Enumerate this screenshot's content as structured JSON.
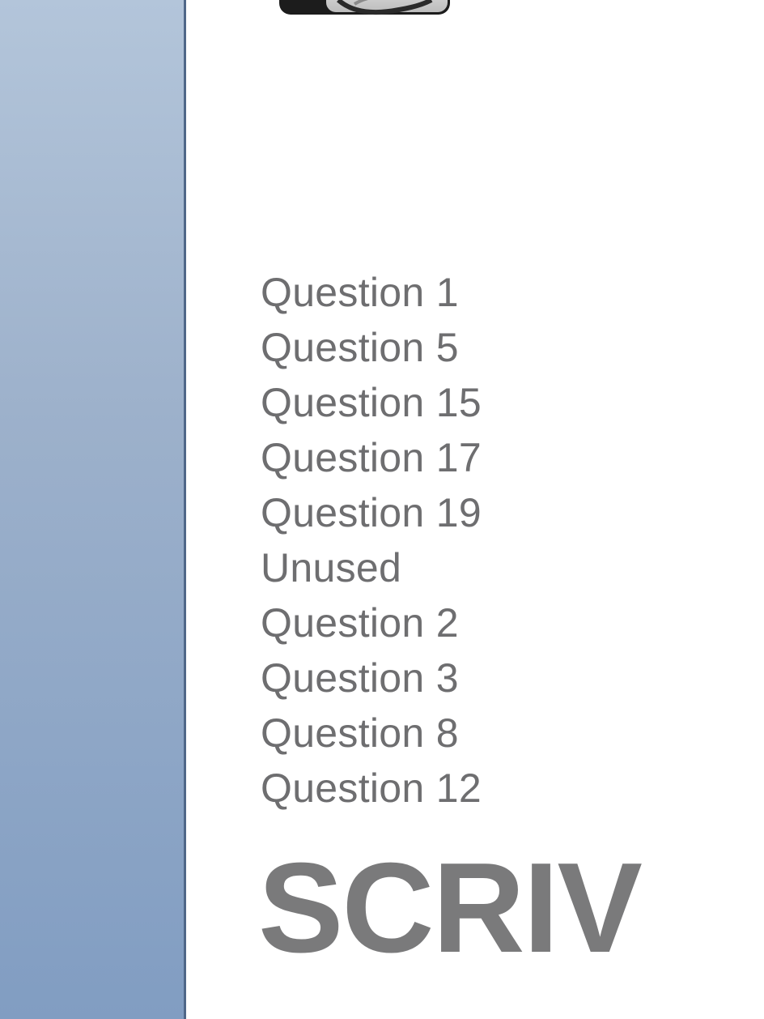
{
  "sidebar": {
    "color_top": "#b3c5da",
    "color_bottom": "#819dc2"
  },
  "app_icon": {
    "icon": "scrivener-app-icon"
  },
  "outline": {
    "items": [
      "Question 1",
      "Question 5",
      "Question 15",
      "Question 17",
      "Question 19",
      "Unused",
      "Question 2",
      "Question 3",
      "Question 8",
      "Question 12"
    ]
  },
  "brand": {
    "text": "SCRIV"
  }
}
